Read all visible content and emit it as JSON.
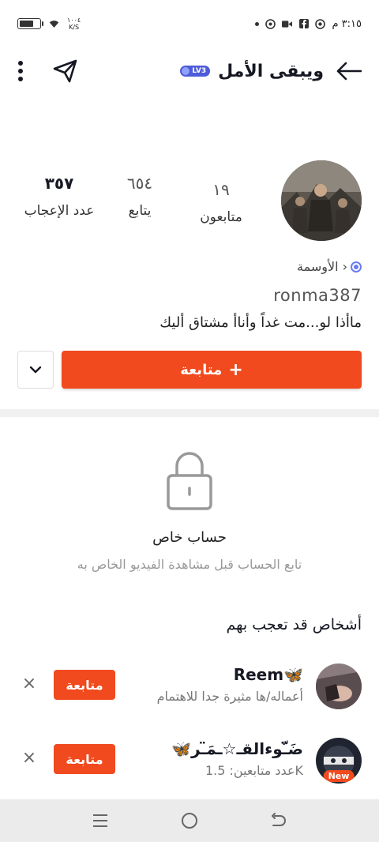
{
  "status_bar": {
    "time": "٣:١٥ م",
    "net_speed_value": "١٠٠٤",
    "net_speed_unit": "K/S"
  },
  "header": {
    "title": "ويبقى الأمل",
    "level_badge": "LV3"
  },
  "profile": {
    "stats": {
      "likes_count": "٣٥٧",
      "likes_label": "عدد الإعجاب",
      "following_count": "٦٥٤",
      "following_label": "يتابع",
      "followers_count": "١٩",
      "followers_label": "متابعون"
    },
    "badges_link": "الأوسمة ›",
    "username": "ronma387",
    "bio": "ماأذا لو...مت غداً وأناأ مشتاق أليك",
    "follow_button": "متابعة",
    "follow_plus": "+"
  },
  "private_account": {
    "title": "حساب خاص",
    "subtitle": "تابع الحساب قبل مشاهدة الفيديو الخاص به"
  },
  "suggestions": {
    "title": "أشخاص قد تعجب بهم",
    "items": [
      {
        "name": "Reem🦋",
        "subtitle": "أعماله/ها مثيرة جدا للاهتمام",
        "follow_label": "متابعة",
        "close": "×"
      },
      {
        "name": "🦋ضَ̈ـّوءالقـ☆ـمَ̈ـر",
        "subtitle": "عدد متابعين: 1.5K",
        "follow_label": "متابعة",
        "close": "×",
        "new_tag": "New"
      }
    ]
  },
  "colors": {
    "accent": "#f04a1e",
    "level_badge": "#4d5cd8"
  }
}
